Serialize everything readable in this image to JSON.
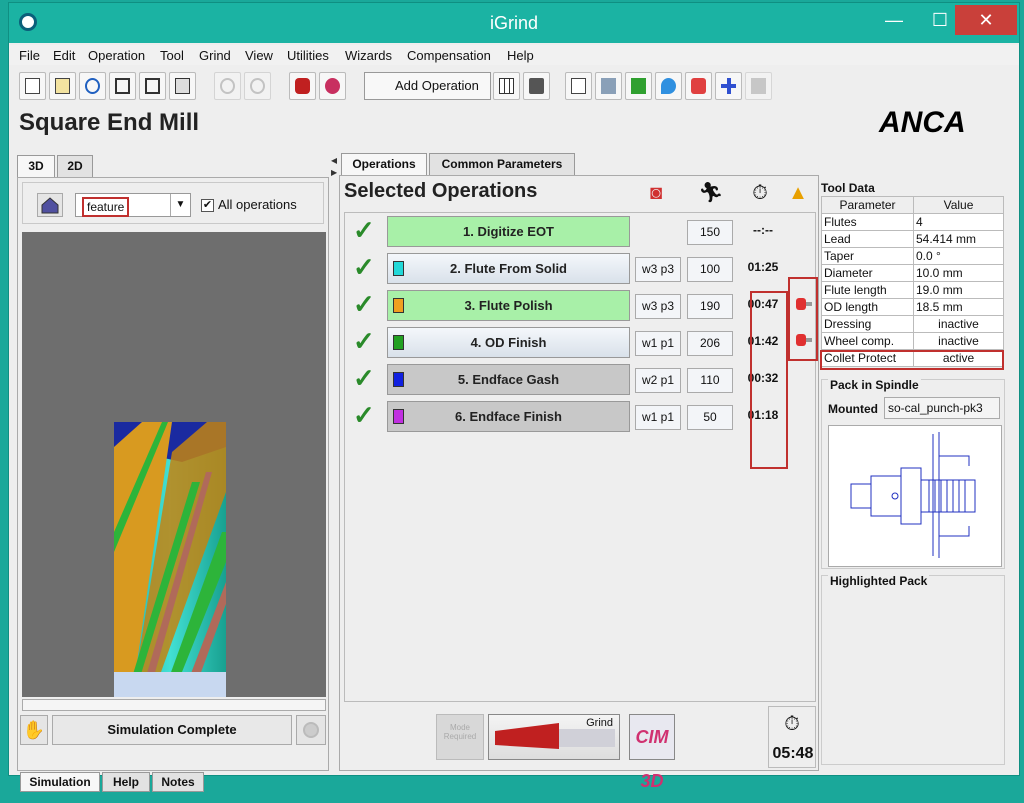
{
  "window": {
    "title": "iGrind",
    "min": "—",
    "max": "☐",
    "close": "✕"
  },
  "menu": [
    "File",
    "Edit",
    "Operation",
    "Tool",
    "Grind",
    "View",
    "Utilities",
    "Wizards",
    "Compensation",
    "Help"
  ],
  "toolbar": {
    "add_operation": "Add Operation"
  },
  "page_title": "Square End Mill",
  "brand": "ANCA",
  "left": {
    "tabs": [
      "3D",
      "2D"
    ],
    "feature_value": "feature",
    "all_operations_label": "All operations",
    "all_operations_checked": true,
    "simulation_status": "Simulation Complete",
    "bottom_tabs": [
      "Simulation",
      "Help",
      "Notes"
    ]
  },
  "center": {
    "tabs": [
      "Operations",
      "Common Parameters"
    ],
    "heading": "Selected Operations",
    "operations": [
      {
        "name": "1. Digitize EOT",
        "color": "",
        "wheel": "",
        "rpm": "150",
        "time": "--:--",
        "style": "green",
        "collet": false
      },
      {
        "name": "2. Flute From Solid",
        "color": "#22d8d8",
        "wheel": "w3 p3",
        "rpm": "100",
        "time": "01:25",
        "style": "normal",
        "collet": true
      },
      {
        "name": "3. Flute Polish",
        "color": "#f0a020",
        "wheel": "w3 p3",
        "rpm": "190",
        "time": "00:47",
        "style": "green",
        "collet": true
      },
      {
        "name": "4. OD Finish",
        "color": "#22a022",
        "wheel": "w1 p1",
        "rpm": "206",
        "time": "01:42",
        "style": "normal",
        "collet": false
      },
      {
        "name": "5. Endface Gash",
        "color": "#1020e0",
        "wheel": "w2 p1",
        "rpm": "110",
        "time": "00:32",
        "style": "gray",
        "collet": false
      },
      {
        "name": "6. Endface Finish",
        "color": "#c030e0",
        "wheel": "w1 p1",
        "rpm": "50",
        "time": "01:18",
        "style": "gray",
        "collet": false
      }
    ],
    "mode_button": "Mode Required",
    "grind_button": "Grind",
    "cim_button": "CIM 3D",
    "total_time": "05:48"
  },
  "tool_data": {
    "title": "Tool Data",
    "headers": [
      "Parameter",
      "Value"
    ],
    "rows": [
      [
        "Flutes",
        "4"
      ],
      [
        "Lead",
        "54.414 mm"
      ],
      [
        "Taper",
        "0.0 °"
      ],
      [
        "Diameter",
        "10.0 mm"
      ],
      [
        "Flute length",
        "19.0 mm"
      ],
      [
        "OD length",
        "18.5 mm"
      ],
      [
        "Dressing",
        "inactive"
      ],
      [
        "Wheel comp.",
        "inactive"
      ],
      [
        "Collet Protect",
        "active"
      ]
    ]
  },
  "pack": {
    "title": "Pack in Spindle",
    "mounted_label": "Mounted",
    "mounted_value": "so-cal_punch-pk3",
    "highlighted_title": "Highlighted Pack"
  }
}
